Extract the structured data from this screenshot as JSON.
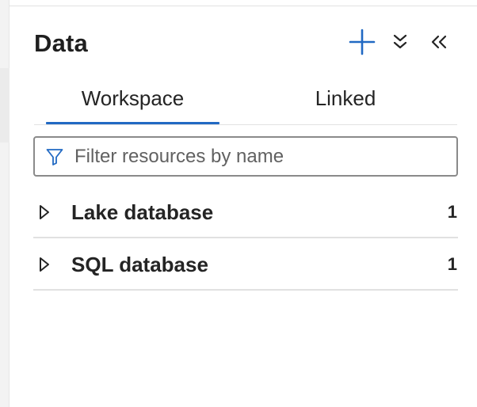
{
  "panel": {
    "title": "Data",
    "icons": {
      "add": "plus-icon",
      "expand": "double-chevron-down-icon",
      "collapse": "double-chevron-left-icon"
    },
    "accent_color": "#2169c3"
  },
  "tabs": [
    {
      "label": "Workspace",
      "selected": true
    },
    {
      "label": "Linked",
      "selected": false
    }
  ],
  "filter": {
    "placeholder": "Filter resources by name",
    "value": "",
    "icon": "filter-funnel-icon"
  },
  "tree": {
    "items": [
      {
        "label": "Lake database",
        "count": "1",
        "expanded": false
      },
      {
        "label": "SQL database",
        "count": "1",
        "expanded": false
      }
    ]
  }
}
